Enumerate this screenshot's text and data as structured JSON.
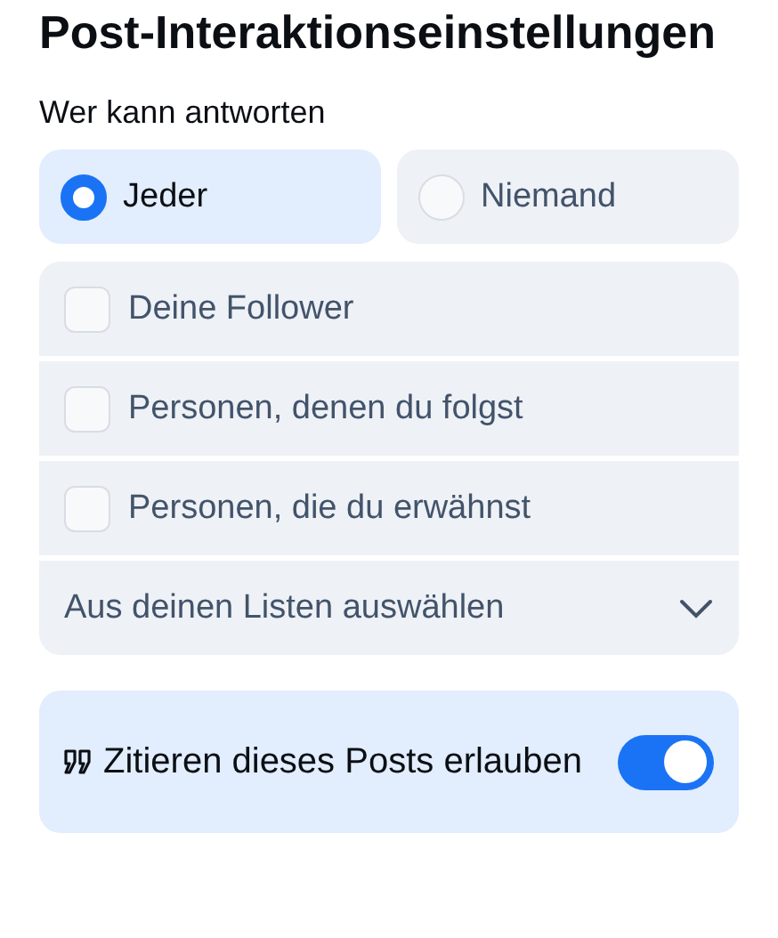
{
  "title": "Post-Interaktionseinstellungen",
  "reply_section": {
    "label": "Wer kann antworten",
    "audience": [
      {
        "label": "Jeder",
        "selected": true
      },
      {
        "label": "Niemand",
        "selected": false
      }
    ],
    "options": [
      {
        "label": "Deine Follower",
        "checked": false
      },
      {
        "label": "Personen, denen du folgst",
        "checked": false
      },
      {
        "label": "Personen, die du erwähnst",
        "checked": false
      }
    ],
    "list_select": {
      "label": "Aus deinen Listen auswählen"
    }
  },
  "quote_setting": {
    "label": "Zitieren dieses Posts erlauben",
    "on": true
  }
}
